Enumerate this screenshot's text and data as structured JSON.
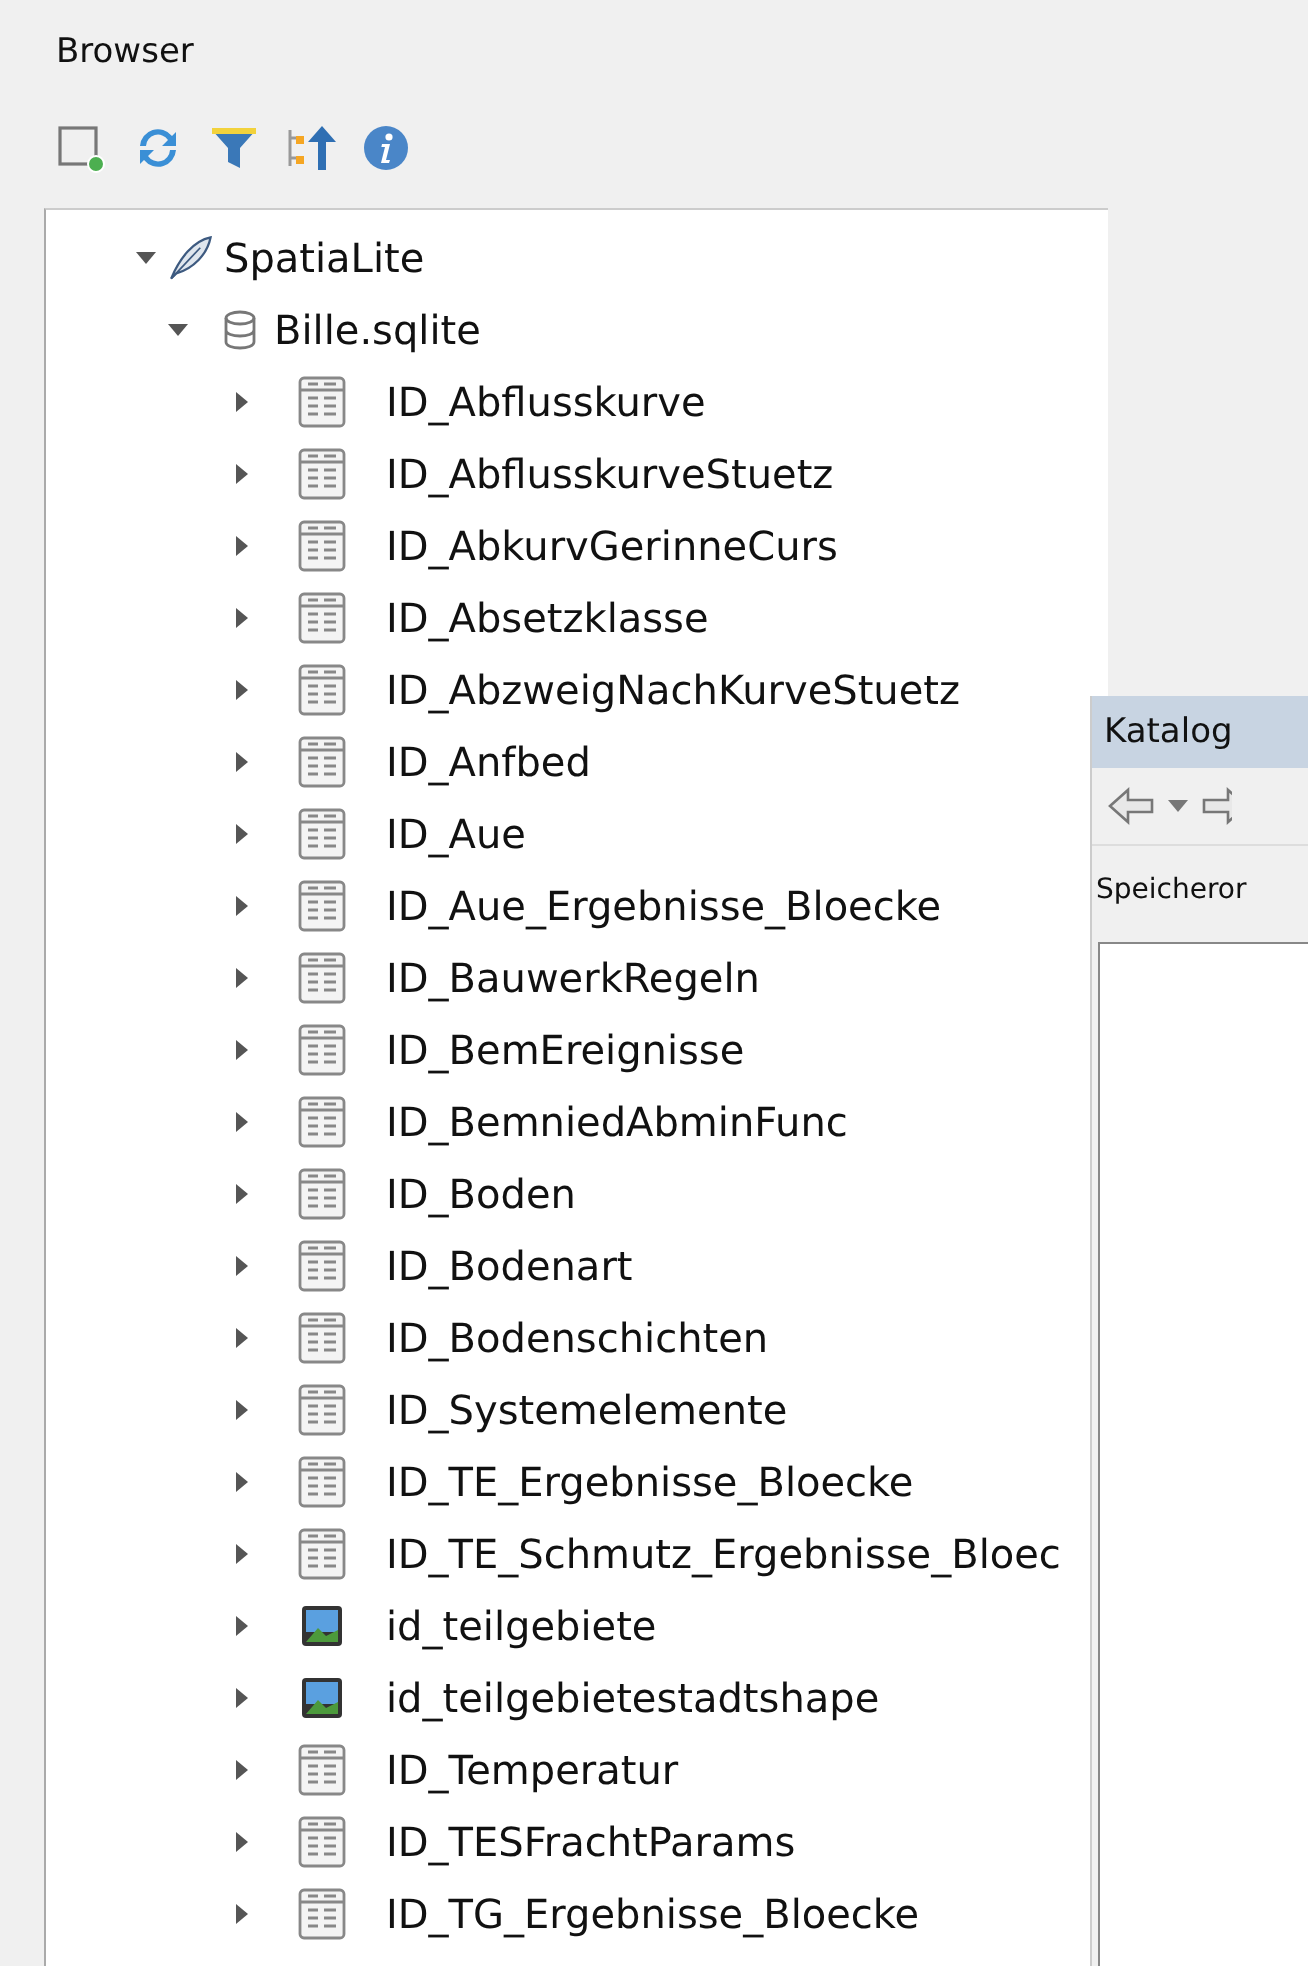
{
  "browser": {
    "title": "Browser",
    "tree": [
      {
        "label": "SpatiaLite",
        "kind": "provider",
        "expanded": true,
        "children": [
          {
            "label": "Bille.sqlite",
            "kind": "database",
            "expanded": true,
            "children": [
              {
                "label": "ID_Abflusskurve",
                "kind": "table",
                "expanded": false
              },
              {
                "label": "ID_AbflusskurveStuetz",
                "kind": "table",
                "expanded": false
              },
              {
                "label": "ID_AbkurvGerinneCurs",
                "kind": "table",
                "expanded": false
              },
              {
                "label": "ID_Absetzklasse",
                "kind": "table",
                "expanded": false
              },
              {
                "label": "ID_AbzweigNachKurveStuetz",
                "kind": "table",
                "expanded": false
              },
              {
                "label": "ID_Anfbed",
                "kind": "table",
                "expanded": false
              },
              {
                "label": "ID_Aue",
                "kind": "table",
                "expanded": false
              },
              {
                "label": "ID_Aue_Ergebnisse_Bloecke",
                "kind": "table",
                "expanded": false
              },
              {
                "label": "ID_BauwerkRegeln",
                "kind": "table",
                "expanded": false
              },
              {
                "label": "ID_BemEreignisse",
                "kind": "table",
                "expanded": false
              },
              {
                "label": "ID_BemniedAbminFunc",
                "kind": "table",
                "expanded": false
              },
              {
                "label": "ID_Boden",
                "kind": "table",
                "expanded": false
              },
              {
                "label": "ID_Bodenart",
                "kind": "table",
                "expanded": false
              },
              {
                "label": "ID_Bodenschichten",
                "kind": "table",
                "expanded": false
              },
              {
                "label": "ID_Systemelemente",
                "kind": "table",
                "expanded": false
              },
              {
                "label": "ID_TE_Ergebnisse_Bloecke",
                "kind": "table",
                "expanded": false
              },
              {
                "label": "ID_TE_Schmutz_Ergebnisse_Bloec",
                "kind": "table",
                "expanded": false
              },
              {
                "label": "id_teilgebiete",
                "kind": "raster",
                "expanded": false
              },
              {
                "label": "id_teilgebietestadtshape",
                "kind": "raster",
                "expanded": false
              },
              {
                "label": "ID_Temperatur",
                "kind": "table",
                "expanded": false
              },
              {
                "label": "ID_TESFrachtParams",
                "kind": "table",
                "expanded": false
              },
              {
                "label": "ID_TG_Ergebnisse_Bloecke",
                "kind": "table",
                "expanded": false
              }
            ]
          }
        ]
      }
    ]
  },
  "catalog": {
    "title": "Katalog",
    "location_label": "Speicheror"
  }
}
